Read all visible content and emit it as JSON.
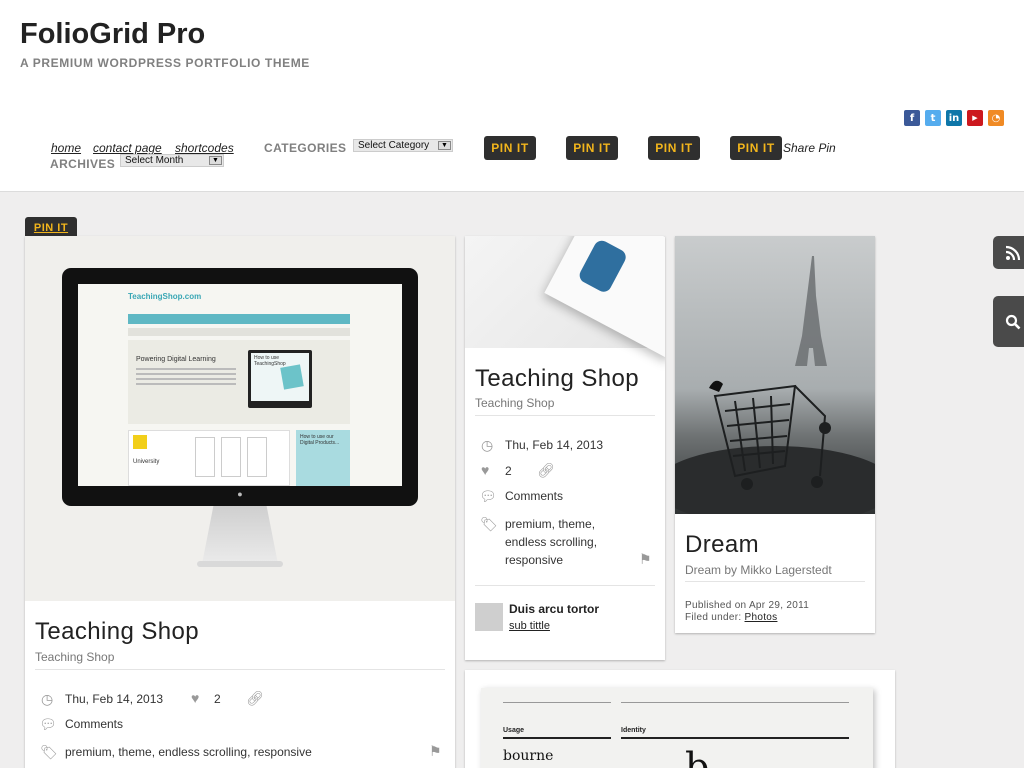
{
  "site": {
    "title": "FolioGrid Pro",
    "tagline": "A PREMIUM WORDPRESS PORTFOLIO THEME"
  },
  "social_icons": [
    "facebook-icon",
    "twitter-icon",
    "linkedin-icon",
    "youtube-icon",
    "rss-icon"
  ],
  "nav": {
    "links": [
      "home",
      "contact page",
      "shortcodes"
    ],
    "categories_label": "CATEGORIES",
    "categories_selected": "Select Category",
    "archives_label": "ARCHIVES",
    "archives_selected": "Select Month",
    "pin_label": "PIN IT",
    "share_pin": "Share Pin"
  },
  "side_tabs": [
    "rss-icon",
    "search-icon"
  ],
  "cards": {
    "main": {
      "pin_label": "PIN IT",
      "title": "Teaching Shop",
      "subtitle": "Teaching Shop",
      "date": "Thu, Feb 14, 2013",
      "likes": "2",
      "comments": "Comments",
      "tags": "premium, theme, endless scrolling, responsive",
      "screen": {
        "logo": "TeachingShop.com",
        "heading": "Powering Digital Learning",
        "howto": "How to use TeachingShop",
        "university": "University",
        "howto2": "How to use our Digital Products..."
      }
    },
    "middle": {
      "title": "Teaching Shop",
      "subtitle": "Teaching Shop",
      "date": "Thu, Feb 14, 2013",
      "likes": "2",
      "comments": "Comments",
      "tags_lines": [
        "premium, theme,",
        "endless scrolling,",
        "responsive"
      ],
      "comment_author": "Duis arcu tortor",
      "comment_link": "sub tittle"
    },
    "dream": {
      "title": "Dream",
      "subtitle": "Dream by Mikko Lagerstedt",
      "published": "Published on Apr 29, 2011",
      "filed_label": "Filed under:",
      "filed_link": "Photos"
    },
    "bottom": {
      "col1": "Usage",
      "col2": "Identity",
      "word": "bourne"
    }
  },
  "colors": {
    "pin_bg": "#2f2f2f",
    "pin_text": "#f2b51c",
    "page_bg": "#efeeee",
    "accent_teal": "#5fb8c4"
  }
}
